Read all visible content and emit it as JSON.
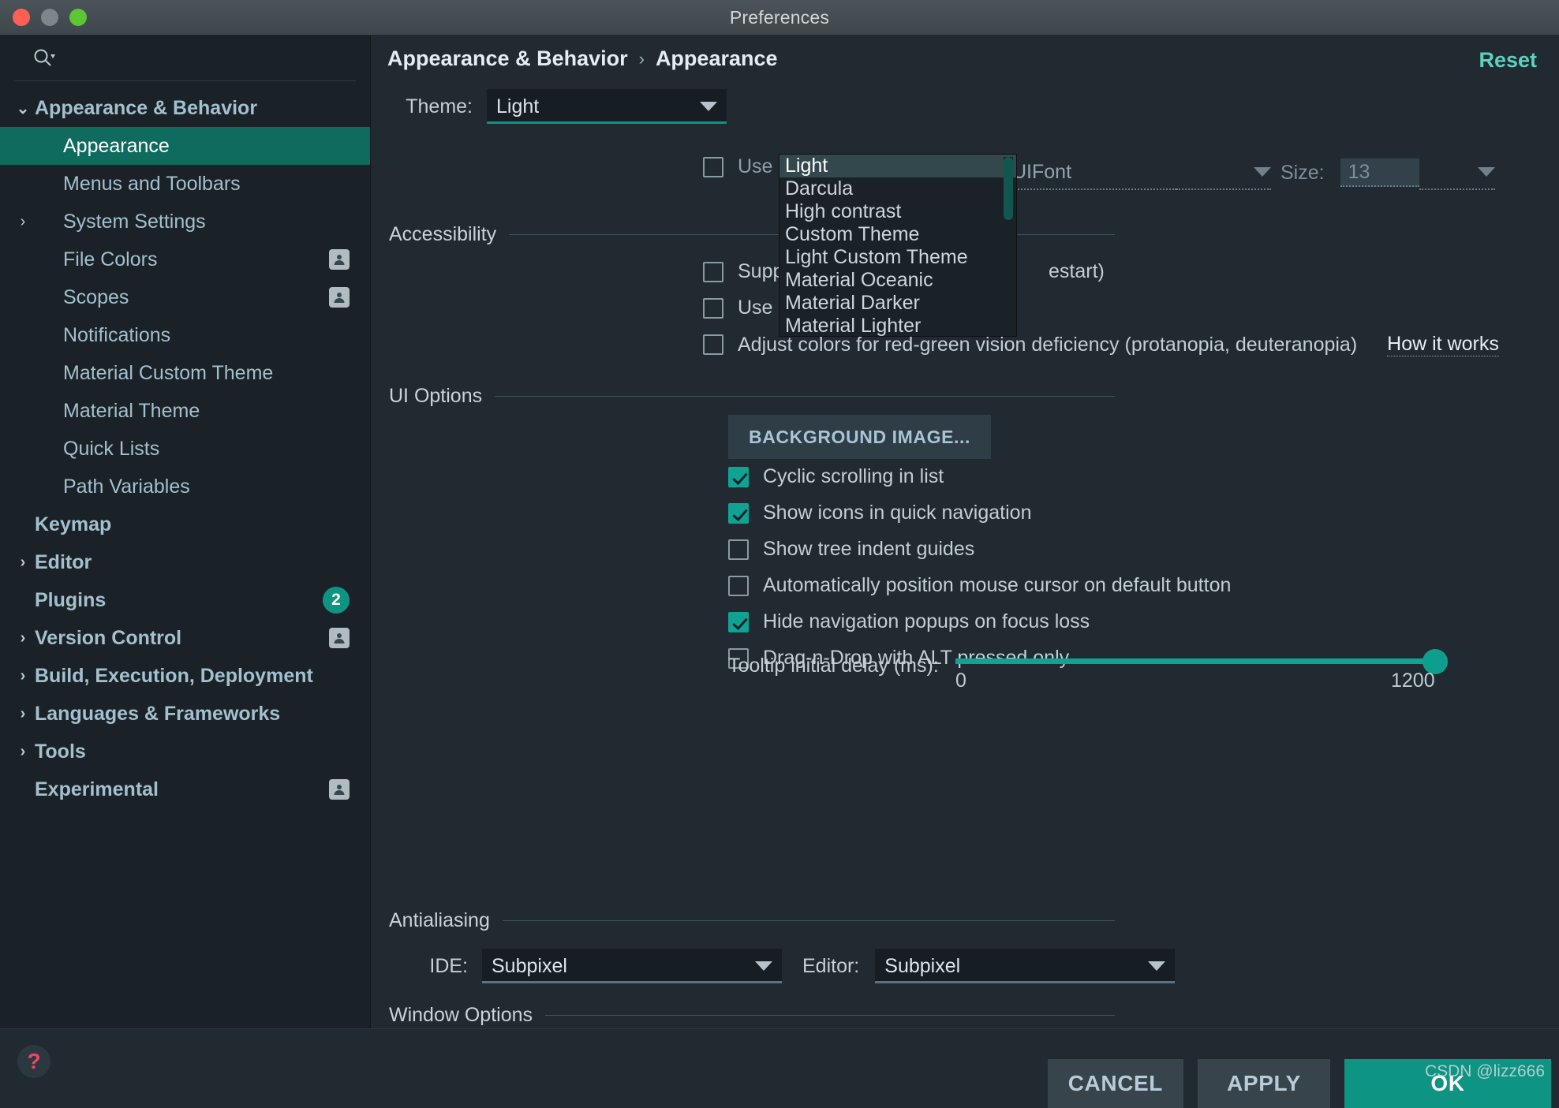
{
  "window": {
    "title": "Preferences",
    "controls": [
      "close-button",
      "minimize-button",
      "zoom-button"
    ]
  },
  "sidebar": {
    "search": {
      "placeholder": "",
      "value": "",
      "icon": "search-icon"
    },
    "items": [
      {
        "label": "Appearance & Behavior",
        "twisty": "⌄",
        "bold": true,
        "selected": false,
        "indent": 0,
        "badge": ""
      },
      {
        "label": "Appearance",
        "twisty": "",
        "bold": false,
        "selected": true,
        "indent": 1,
        "badge": ""
      },
      {
        "label": "Menus and Toolbars",
        "twisty": "",
        "bold": false,
        "selected": false,
        "indent": 1,
        "badge": ""
      },
      {
        "label": "System Settings",
        "twisty": "›",
        "bold": false,
        "selected": false,
        "indent": 1,
        "badge": ""
      },
      {
        "label": "File Colors",
        "twisty": "",
        "bold": false,
        "selected": false,
        "indent": 1,
        "badge": "person"
      },
      {
        "label": "Scopes",
        "twisty": "",
        "bold": false,
        "selected": false,
        "indent": 1,
        "badge": "person"
      },
      {
        "label": "Notifications",
        "twisty": "",
        "bold": false,
        "selected": false,
        "indent": 1,
        "badge": ""
      },
      {
        "label": "Material Custom Theme",
        "twisty": "",
        "bold": false,
        "selected": false,
        "indent": 1,
        "badge": ""
      },
      {
        "label": "Material Theme",
        "twisty": "",
        "bold": false,
        "selected": false,
        "indent": 1,
        "badge": ""
      },
      {
        "label": "Quick Lists",
        "twisty": "",
        "bold": false,
        "selected": false,
        "indent": 1,
        "badge": ""
      },
      {
        "label": "Path Variables",
        "twisty": "",
        "bold": false,
        "selected": false,
        "indent": 1,
        "badge": ""
      },
      {
        "label": "Keymap",
        "twisty": "",
        "bold": true,
        "selected": false,
        "indent": 0,
        "badge": ""
      },
      {
        "label": "Editor",
        "twisty": "›",
        "bold": true,
        "selected": false,
        "indent": 0,
        "badge": ""
      },
      {
        "label": "Plugins",
        "twisty": "",
        "bold": true,
        "selected": false,
        "indent": 0,
        "badge": "count",
        "count": "2"
      },
      {
        "label": "Version Control",
        "twisty": "›",
        "bold": true,
        "selected": false,
        "indent": 0,
        "badge": "person"
      },
      {
        "label": "Build, Execution, Deployment",
        "twisty": "›",
        "bold": true,
        "selected": false,
        "indent": 0,
        "badge": ""
      },
      {
        "label": "Languages & Frameworks",
        "twisty": "›",
        "bold": true,
        "selected": false,
        "indent": 0,
        "badge": ""
      },
      {
        "label": "Tools",
        "twisty": "›",
        "bold": true,
        "selected": false,
        "indent": 0,
        "badge": ""
      },
      {
        "label": "Experimental",
        "twisty": "",
        "bold": true,
        "selected": false,
        "indent": 0,
        "badge": "person"
      }
    ]
  },
  "header": {
    "breadcrumb_root": "Appearance & Behavior",
    "breadcrumb_sep": "›",
    "breadcrumb_leaf": "Appearance",
    "reset_label": "Reset"
  },
  "theme_row": {
    "label": "Theme:",
    "value": "Light",
    "caret": "chevron-down-icon"
  },
  "theme_dropdown": {
    "open": true,
    "selected": "Light",
    "options": [
      "Light",
      "Darcula",
      "High contrast",
      "Custom Theme",
      "Light Custom Theme",
      "Material Oceanic",
      "Material Darker",
      "Material Lighter"
    ]
  },
  "font_row": {
    "checkbox_label": "Use c",
    "checked": false,
    "font_value": "UIFont",
    "size_label": "Size:",
    "size_value": "13"
  },
  "accessibility": {
    "title": "Accessibility",
    "items": [
      {
        "label": "Supp",
        "suffix": "estart)",
        "checked": false
      },
      {
        "label": "Use c",
        "suffix": "",
        "checked": false
      },
      {
        "label": "Adjust colors for red-green vision deficiency (protanopia, deuteranopia)",
        "suffix": "",
        "checked": false
      }
    ],
    "how_it_works": "How it works"
  },
  "ui_options": {
    "title": "UI Options",
    "background_image_button": "BACKGROUND IMAGE...",
    "checkboxes": [
      {
        "label": "Cyclic scrolling in list",
        "checked": true
      },
      {
        "label": "Show icons in quick navigation",
        "checked": true
      },
      {
        "label": "Show tree indent guides",
        "checked": false
      },
      {
        "label": "Automatically position mouse cursor on default button",
        "checked": false
      },
      {
        "label": "Hide navigation popups on focus loss",
        "checked": true
      },
      {
        "label": "Drag-n-Drop with ALT pressed only",
        "checked": false
      }
    ],
    "slider": {
      "label": "Tooltip initial delay (ms):",
      "min_label": "0",
      "max_label": "1200",
      "value": 1200,
      "min": 0,
      "max": 1200
    }
  },
  "antialiasing": {
    "title": "Antialiasing",
    "ide_label": "IDE:",
    "ide_value": "Subpixel",
    "editor_label": "Editor:",
    "editor_value": "Subpixel"
  },
  "window_options": {
    "title": "Window Options"
  },
  "footer": {
    "help_glyph": "?",
    "cancel_label": "CANCEL",
    "apply_label": "APPLY",
    "ok_label": "OK",
    "watermark": "CSDN @lizz666"
  },
  "colors": {
    "accent": "#0e9483",
    "sidebar_bg": "#1b2227",
    "main_bg": "#212a31",
    "selection": "#0e6b5d",
    "text": "#c3ced4",
    "link": "#5fd0bf"
  }
}
